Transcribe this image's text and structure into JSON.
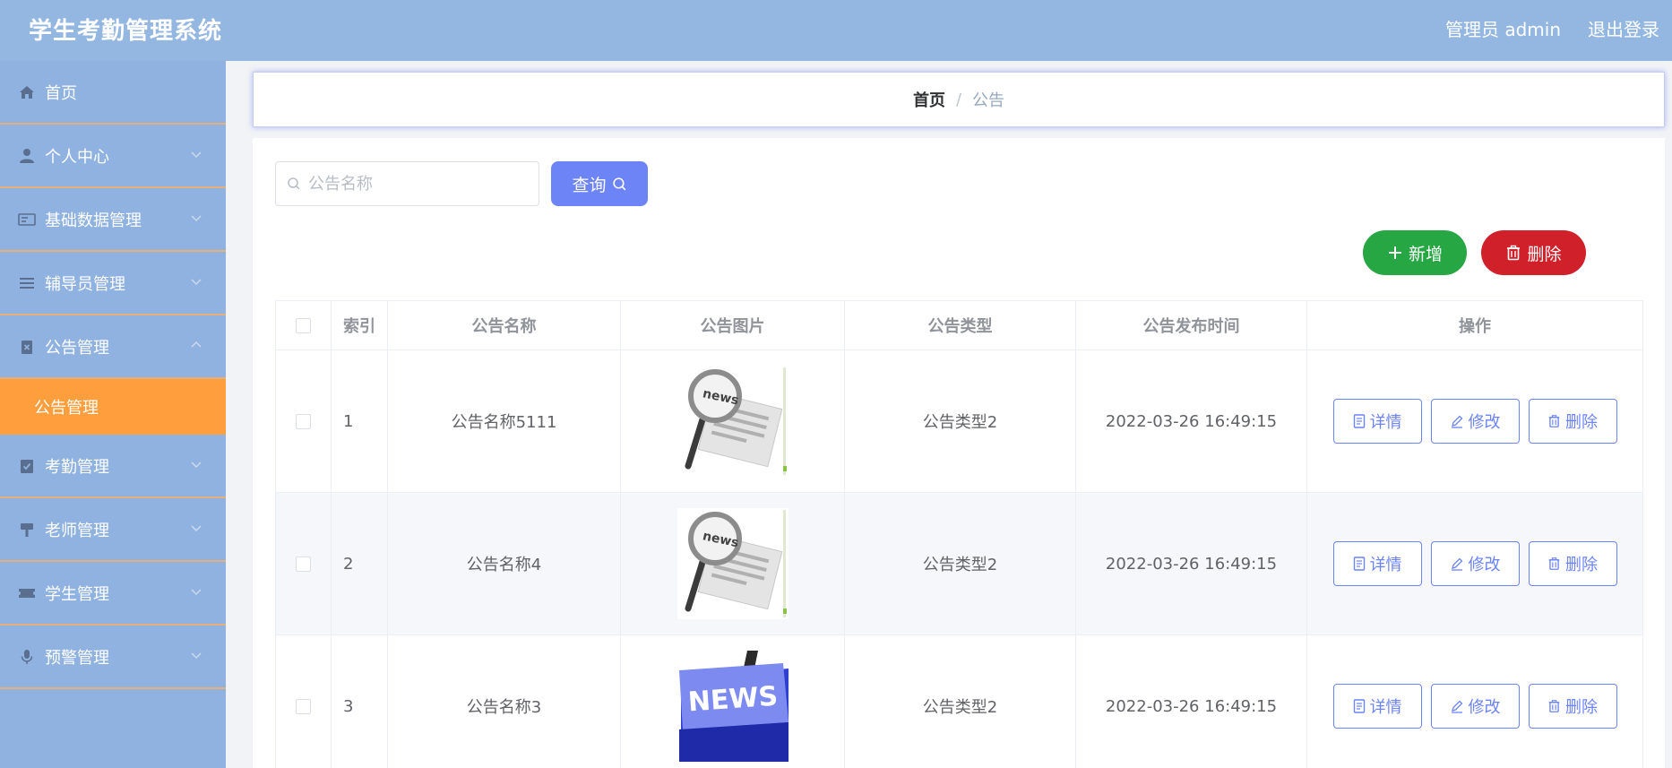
{
  "header": {
    "app_title": "学生考勤管理系统",
    "admin_label": "管理员 admin",
    "logout_label": "退出登录"
  },
  "sidebar": {
    "items": [
      {
        "label": "首页",
        "icon": "home-icon"
      },
      {
        "label": "个人中心",
        "icon": "user-icon"
      },
      {
        "label": "基础数据管理",
        "icon": "id-card-icon"
      },
      {
        "label": "辅导员管理",
        "icon": "list-icon"
      },
      {
        "label": "公告管理",
        "icon": "document-delete-icon"
      },
      {
        "label": "考勤管理",
        "icon": "clipboard-check-icon"
      },
      {
        "label": "老师管理",
        "icon": "brush-icon"
      },
      {
        "label": "学生管理",
        "icon": "ticket-icon"
      },
      {
        "label": "预警管理",
        "icon": "microphone-icon"
      }
    ],
    "active_submenu": "公告管理"
  },
  "breadcrumb": {
    "home": "首页",
    "separator": "/",
    "current": "公告"
  },
  "toolbar": {
    "search_placeholder": "公告名称",
    "query_label": "查询",
    "add_label": "新增",
    "delete_label": "删除"
  },
  "colors": {
    "header_bg": "#94b7e2",
    "sidebar_bg": "#8fb2e0",
    "active_submenu_bg": "#ff9e3d",
    "primary": "#6c84f5",
    "success": "#27a744",
    "danger": "#d0202a"
  },
  "table": {
    "columns": [
      "索引",
      "公告名称",
      "公告图片",
      "公告类型",
      "公告发布时间",
      "操作"
    ],
    "rows": [
      {
        "index": "1",
        "name": "公告名称5111",
        "image": "news-magnifier-image",
        "type": "公告类型2",
        "time": "2022-03-26 16:49:15"
      },
      {
        "index": "2",
        "name": "公告名称4",
        "image": "news-magnifier-image",
        "type": "公告类型2",
        "time": "2022-03-26 16:49:15"
      },
      {
        "index": "3",
        "name": "公告名称3",
        "image": "news-keyboard-key-image",
        "type": "公告类型2",
        "time": "2022-03-26 16:49:15"
      }
    ],
    "row_actions": {
      "detail": "详情",
      "edit": "修改",
      "delete": "删除"
    }
  }
}
